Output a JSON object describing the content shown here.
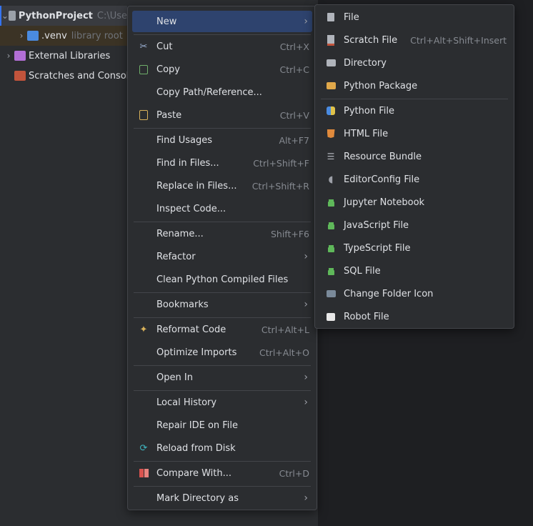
{
  "tree": {
    "project": {
      "name": "PythonProject",
      "path": "C:\\Use"
    },
    "venv": {
      "name": ".venv",
      "hint": "library root"
    },
    "external": "External Libraries",
    "scratches": "Scratches and Console"
  },
  "context_menu": {
    "new": "New",
    "cut": {
      "label": "Cut",
      "shortcut": "Ctrl+X"
    },
    "copy": {
      "label": "Copy",
      "shortcut": "Ctrl+C"
    },
    "copy_path": "Copy Path/Reference...",
    "paste": {
      "label": "Paste",
      "shortcut": "Ctrl+V"
    },
    "find_usages": {
      "label": "Find Usages",
      "shortcut": "Alt+F7"
    },
    "find_in_files": {
      "label": "Find in Files...",
      "shortcut": "Ctrl+Shift+F"
    },
    "replace_in_files": {
      "label": "Replace in Files...",
      "shortcut": "Ctrl+Shift+R"
    },
    "inspect_code": "Inspect Code...",
    "rename": {
      "label": "Rename...",
      "shortcut": "Shift+F6"
    },
    "refactor": "Refactor",
    "clean_python": "Clean Python Compiled Files",
    "bookmarks": "Bookmarks",
    "reformat": {
      "label": "Reformat Code",
      "shortcut": "Ctrl+Alt+L"
    },
    "optimize": {
      "label": "Optimize Imports",
      "shortcut": "Ctrl+Alt+O"
    },
    "open_in": "Open In",
    "local_history": "Local History",
    "repair_ide": "Repair IDE on File",
    "reload": "Reload from Disk",
    "compare": {
      "label": "Compare With...",
      "shortcut": "Ctrl+D"
    },
    "mark_dir": "Mark Directory as"
  },
  "new_submenu": {
    "file": "File",
    "scratch": {
      "label": "Scratch File",
      "shortcut": "Ctrl+Alt+Shift+Insert"
    },
    "directory": "Directory",
    "python_package": "Python Package",
    "python_file": "Python File",
    "html_file": "HTML File",
    "resource_bundle": "Resource Bundle",
    "editorconfig": "EditorConfig File",
    "jupyter": "Jupyter Notebook",
    "javascript": "JavaScript File",
    "typescript": "TypeScript File",
    "sql": "SQL File",
    "change_folder_icon": "Change Folder Icon",
    "robot": "Robot File"
  },
  "colors": {
    "highlight": "#2e436e",
    "menu_bg": "#2b2d30",
    "accent": "#3574f0"
  }
}
